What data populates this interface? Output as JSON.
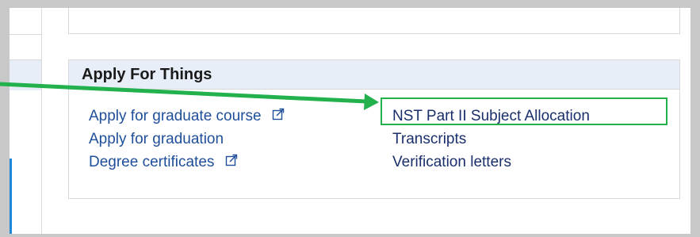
{
  "panel": {
    "title": "Apply For Things",
    "left_links": [
      {
        "label": "Apply for graduate course",
        "icon": "external-link-icon"
      },
      {
        "label": "Apply for graduation"
      },
      {
        "label": "Degree certificates",
        "icon": "external-link-icon"
      }
    ],
    "right_links": [
      {
        "label": "NST Part II Subject Allocation"
      },
      {
        "label": "Transcripts"
      },
      {
        "label": "Verification letters"
      }
    ]
  },
  "colors": {
    "link": "#1f4e9a",
    "header_bg": "#e7eef8",
    "highlight": "#22b14c",
    "accent": "#1e88d8"
  }
}
